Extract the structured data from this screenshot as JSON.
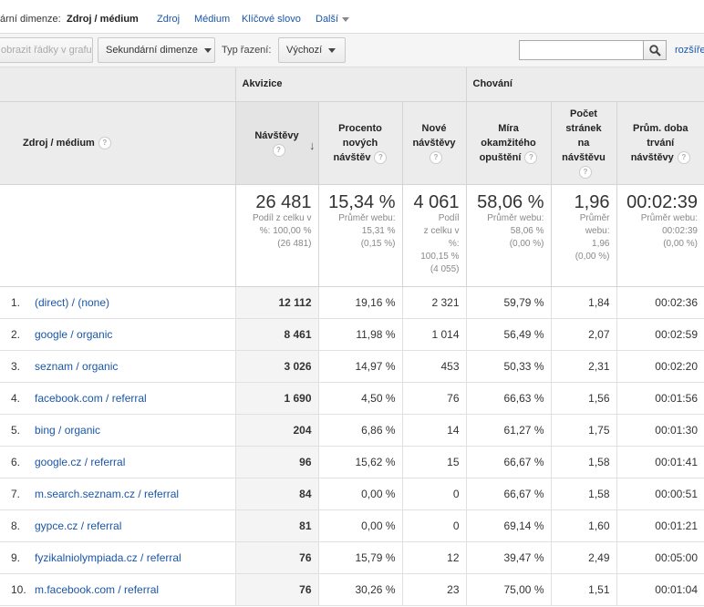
{
  "dimbar": {
    "label": "ární dimenze:",
    "current": "Zdroj / médium",
    "options": [
      "Zdroj",
      "Médium",
      "Klíčové slovo",
      "Další"
    ]
  },
  "toolbar": {
    "plot_rows": "obrazit řádky v grafu",
    "secondary_dimension": "Sekundární dimenze",
    "sort_type_label": "Typ řazení:",
    "sort_type_value": "Výchozí",
    "search_value": "",
    "advanced_link": "rozšíře"
  },
  "table": {
    "group_acquisition": "Akvizice",
    "group_behavior": "Chování",
    "col_source": "Zdroj / médium",
    "col_visits": "Návštěvy",
    "col_new_pct": [
      "Procento",
      "nových",
      "návštěv"
    ],
    "col_new_visits": [
      "Nové",
      "návštěvy"
    ],
    "col_bounce": [
      "Míra",
      "okamžitého",
      "opuštění"
    ],
    "col_pages": [
      "Počet",
      "stránek",
      "na",
      "návštěvu"
    ],
    "col_duration": [
      "Prům. doba",
      "trvání",
      "návštěvy"
    ],
    "help_glyph": "?",
    "sort_arrow": "↓",
    "totals": {
      "visits": {
        "big": "26 481",
        "small": [
          "Podíl z celku v",
          "%: 100,00 %",
          "(26 481)"
        ]
      },
      "new_pct": {
        "big": "15,34 %",
        "small": [
          "Průměr webu:",
          "15,31 %",
          "(0,15 %)"
        ]
      },
      "new_visits": {
        "big": "4 061",
        "small": [
          "Podíl",
          "z celku v",
          "%:",
          "100,15 %",
          "(4 055)"
        ]
      },
      "bounce": {
        "big": "58,06 %",
        "small": [
          "Průměr webu:",
          "58,06 %",
          "(0,00 %)"
        ]
      },
      "pages": {
        "big": "1,96",
        "small": [
          "Průměr",
          "webu:",
          "1,96",
          "(0,00 %)"
        ]
      },
      "duration": {
        "big": "00:02:39",
        "small": [
          "Průměr webu:",
          "00:02:39",
          "(0,00 %)"
        ]
      }
    },
    "rows": [
      {
        "num": "1.",
        "source": "(direct) / (none)",
        "visits": "12 112",
        "new_pct": "19,16 %",
        "new_visits": "2 321",
        "bounce": "59,79 %",
        "pages": "1,84",
        "duration": "00:02:36"
      },
      {
        "num": "2.",
        "source": "google / organic",
        "visits": "8 461",
        "new_pct": "11,98 %",
        "new_visits": "1 014",
        "bounce": "56,49 %",
        "pages": "2,07",
        "duration": "00:02:59"
      },
      {
        "num": "3.",
        "source": "seznam / organic",
        "visits": "3 026",
        "new_pct": "14,97 %",
        "new_visits": "453",
        "bounce": "50,33 %",
        "pages": "2,31",
        "duration": "00:02:20"
      },
      {
        "num": "4.",
        "source": "facebook.com / referral",
        "visits": "1 690",
        "new_pct": "4,50 %",
        "new_visits": "76",
        "bounce": "66,63 %",
        "pages": "1,56",
        "duration": "00:01:56"
      },
      {
        "num": "5.",
        "source": "bing / organic",
        "visits": "204",
        "new_pct": "6,86 %",
        "new_visits": "14",
        "bounce": "61,27 %",
        "pages": "1,75",
        "duration": "00:01:30"
      },
      {
        "num": "6.",
        "source": "google.cz / referral",
        "visits": "96",
        "new_pct": "15,62 %",
        "new_visits": "15",
        "bounce": "66,67 %",
        "pages": "1,58",
        "duration": "00:01:41"
      },
      {
        "num": "7.",
        "source": "m.search.seznam.cz / referral",
        "visits": "84",
        "new_pct": "0,00 %",
        "new_visits": "0",
        "bounce": "66,67 %",
        "pages": "1,58",
        "duration": "00:00:51"
      },
      {
        "num": "8.",
        "source": "gypce.cz / referral",
        "visits": "81",
        "new_pct": "0,00 %",
        "new_visits": "0",
        "bounce": "69,14 %",
        "pages": "1,60",
        "duration": "00:01:21"
      },
      {
        "num": "9.",
        "source": "fyzikalniolympiada.cz / referral",
        "visits": "76",
        "new_pct": "15,79 %",
        "new_visits": "12",
        "bounce": "39,47 %",
        "pages": "2,49",
        "duration": "00:05:00"
      },
      {
        "num": "10.",
        "source": "m.facebook.com / referral",
        "visits": "76",
        "new_pct": "30,26 %",
        "new_visits": "23",
        "bounce": "75,00 %",
        "pages": "1,51",
        "duration": "00:01:04"
      }
    ]
  }
}
